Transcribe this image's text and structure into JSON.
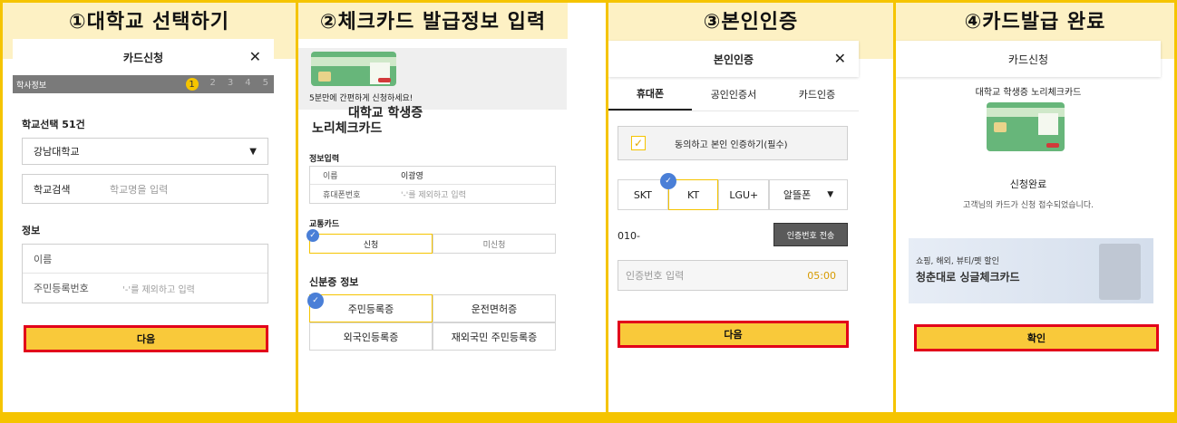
{
  "steps": [
    {
      "heading": "①대학교 선택하기",
      "header_title": "카드신청",
      "section_bar": "학사정보",
      "step_numbers": [
        "1",
        "2",
        "3",
        "4",
        "5"
      ],
      "school_count_label": "학교선택 51건",
      "school_select_value": "강남대학교",
      "school_search_label": "학교검색",
      "school_search_placeholder": "학교명을 입력",
      "info_label": "정보",
      "name_label": "이름",
      "id_label": "주민등록번호",
      "id_placeholder": "'-'를 제외하고 입력",
      "next_label": "다음"
    },
    {
      "heading": "②체크카드 발급정보 입력",
      "banner_text": "5분만에 간편하게 신청하세요!",
      "title_line1": "대학교 학생증",
      "title_line2": "노리체크카드",
      "info_input_label": "정보입력",
      "name_label": "이름",
      "name_value": "이광영",
      "phone_label": "휴대폰번호",
      "phone_placeholder": "'-'를 제외하고 입력",
      "transit_label": "교통카드",
      "transit_options": [
        "신청",
        "미신청"
      ],
      "id_info_label": "신분증 정보",
      "id_options": [
        "주민등록증",
        "운전면허증",
        "외국인등록증",
        "재외국민 주민등록증"
      ]
    },
    {
      "heading": "③본인인증",
      "header_title": "본인인증",
      "tabs": [
        "휴대폰",
        "공인인증서",
        "카드인증"
      ],
      "agree_label": "동의하고 본인 인증하기(필수)",
      "carriers": [
        "SKT",
        "KT",
        "LGU+",
        "알뜰폰"
      ],
      "phone_prefix": "010-",
      "send_code_label": "인증번호 전송",
      "code_placeholder": "인증번호 입력",
      "timer": "05:00",
      "next_label": "다음"
    },
    {
      "heading": "④카드발급 완료",
      "header_title": "카드신청",
      "card_name": "대학교 학생증 노리체크카드",
      "done_title": "신청완료",
      "done_desc": "고객님의 카드가 신청 접수되었습니다.",
      "promo_small": "쇼핑, 해외, 뷰티/펫 할인",
      "promo_big": "청춘대로 싱글체크카드",
      "confirm_label": "확인"
    }
  ],
  "colors": {
    "accent": "#f5c400",
    "button": "#f9c93a",
    "highlight": "#e2001a",
    "bar": "#7a7a7a",
    "check": "#4a7fd7"
  },
  "icons": [
    "close-icon",
    "chevron-down-icon",
    "check-icon"
  ]
}
